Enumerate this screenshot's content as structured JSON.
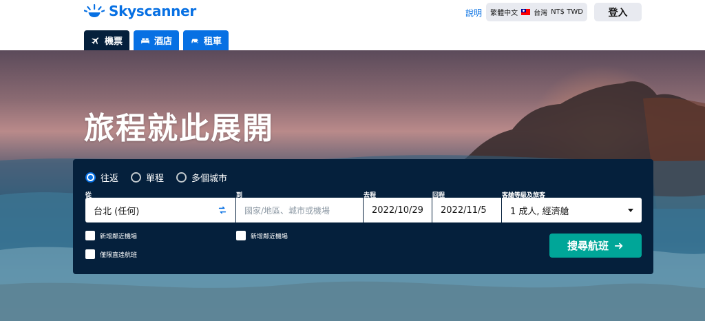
{
  "header": {
    "brand": "Skyscanner",
    "help_label": "說明",
    "locale": {
      "language": "繁體中文",
      "region": "台灣",
      "currency": "NT$ TWD"
    },
    "login_label": "登入"
  },
  "tabs": [
    {
      "label": "機票",
      "icon": "plane-icon",
      "active": true
    },
    {
      "label": "酒店",
      "icon": "bed-icon",
      "active": false
    },
    {
      "label": "租車",
      "icon": "car-icon",
      "active": false
    }
  ],
  "hero": {
    "headline": "旅程就此展開"
  },
  "search": {
    "trip_types": [
      {
        "label": "往返",
        "selected": true
      },
      {
        "label": "單程",
        "selected": false
      },
      {
        "label": "多個城市",
        "selected": false
      }
    ],
    "from": {
      "label": "從",
      "value": "台北 (任何)"
    },
    "to": {
      "label": "到",
      "placeholder": "國家/地區、城市或機場"
    },
    "depart": {
      "label": "去程",
      "value": "2022/10/29"
    },
    "return": {
      "label": "回程",
      "value": "2022/11/5"
    },
    "cabin": {
      "label": "客艙等級及旅客",
      "value": "1 成人, 經濟艙"
    },
    "nearby_from_label": "新增鄰近機場",
    "nearby_to_label": "新增鄰近機場",
    "direct_only_label": "僅限直達航班",
    "submit_label": "搜尋航班"
  },
  "colors": {
    "brand_blue": "#0770e3",
    "navy": "#05203c",
    "teal": "#00a698"
  }
}
